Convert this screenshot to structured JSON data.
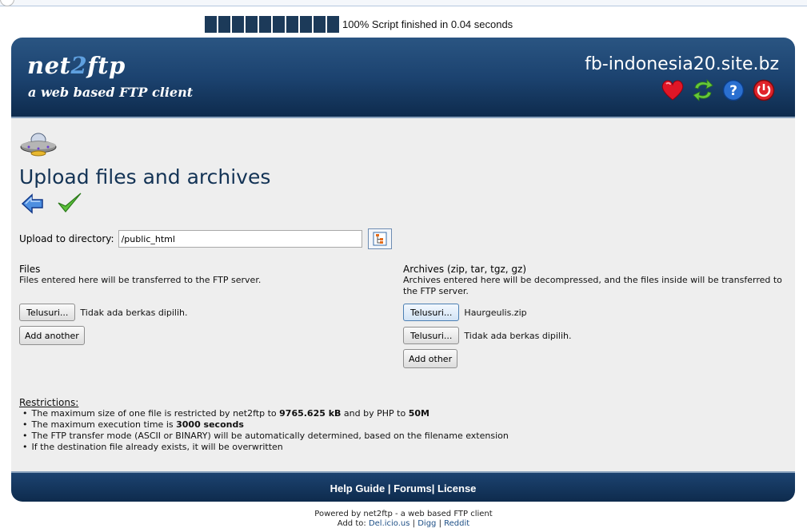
{
  "progress": {
    "percent": 100,
    "blocks": 10,
    "text": "100% Script finished in 0.04 seconds"
  },
  "header": {
    "logo_pre": "net",
    "logo_two": "2",
    "logo_post": "ftp",
    "tagline": "a web based FTP client",
    "site": "fb-indonesia20.site.bz",
    "icons": [
      "bookmark-heart-icon",
      "refresh-icon",
      "help-icon",
      "logout-icon"
    ]
  },
  "page": {
    "title": "Upload files and archives",
    "upload_label": "Upload to directory:",
    "upload_value": "/public_html"
  },
  "files": {
    "heading": "Files",
    "description": "Files entered here will be transferred to the FTP server.",
    "browse_label": "Telusuri...",
    "no_file": "Tidak ada berkas dipilih.",
    "add_label": "Add another"
  },
  "archives": {
    "heading": "Archives (zip, tar, tgz, gz)",
    "description": "Archives entered here will be decompressed, and the files inside will be transferred to the FTP server.",
    "browse_label": "Telusuri...",
    "file1": "Haurgeulis.zip",
    "file2": "Tidak ada berkas dipilih.",
    "add_label": "Add other"
  },
  "restrictions": {
    "heading": "Restrictions:",
    "r1_pre": "The maximum size of one file is restricted by net2ftp to ",
    "r1_b1": "9765.625 kB",
    "r1_mid": " and by PHP to ",
    "r1_b2": "50M",
    "r2_pre": "The maximum execution time is ",
    "r2_b": "3000 seconds",
    "r3": "The FTP transfer mode (ASCII or BINARY) will be automatically determined, based on the filename extension",
    "r4": "If the destination file already exists, it will be overwritten"
  },
  "footer": {
    "help": "Help Guide",
    "sep1": " | ",
    "forums": "Forums",
    "sep2": "| ",
    "license": "License"
  },
  "powered": {
    "line1": "Powered by net2ftp - a web based FTP client",
    "addto": "Add to: ",
    "delicious": "Del.icio.us",
    "sep1": " | ",
    "digg": "Digg",
    "sep2": " | ",
    "reddit": "Reddit"
  }
}
